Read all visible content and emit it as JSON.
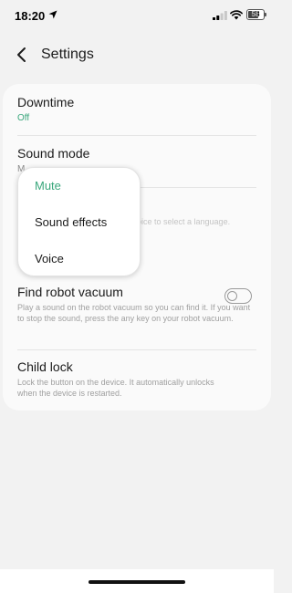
{
  "status_bar": {
    "time": "18:20",
    "battery": "58",
    "icons": [
      "location-arrow-icon",
      "cellular-signal-icon",
      "wifi-icon",
      "battery-icon"
    ]
  },
  "header": {
    "back_icon": "chevron-left-icon",
    "title": "Settings"
  },
  "settings": {
    "downtime": {
      "label": "Downtime",
      "value": "Off"
    },
    "sound_mode": {
      "label": "Sound mode",
      "value_partial": "M"
    },
    "language": {
      "description_partial": "oice to select a language."
    },
    "find_robot": {
      "label": "Find robot vacuum",
      "description": "Play a sound on the robot vacuum so you can find it. If you want to stop the sound, press the any key on your robot vacuum."
    },
    "child_lock": {
      "label": "Child lock",
      "description": "Lock the button on the device. It automatically unlocks when the device is restarted.",
      "enabled": false
    }
  },
  "sound_menu": {
    "options": [
      "Mute",
      "Sound effects",
      "Voice"
    ],
    "selected": "Mute"
  },
  "colors": {
    "accent": "#3aa77c",
    "background": "#f2f2f2",
    "card": "#fafafa"
  }
}
